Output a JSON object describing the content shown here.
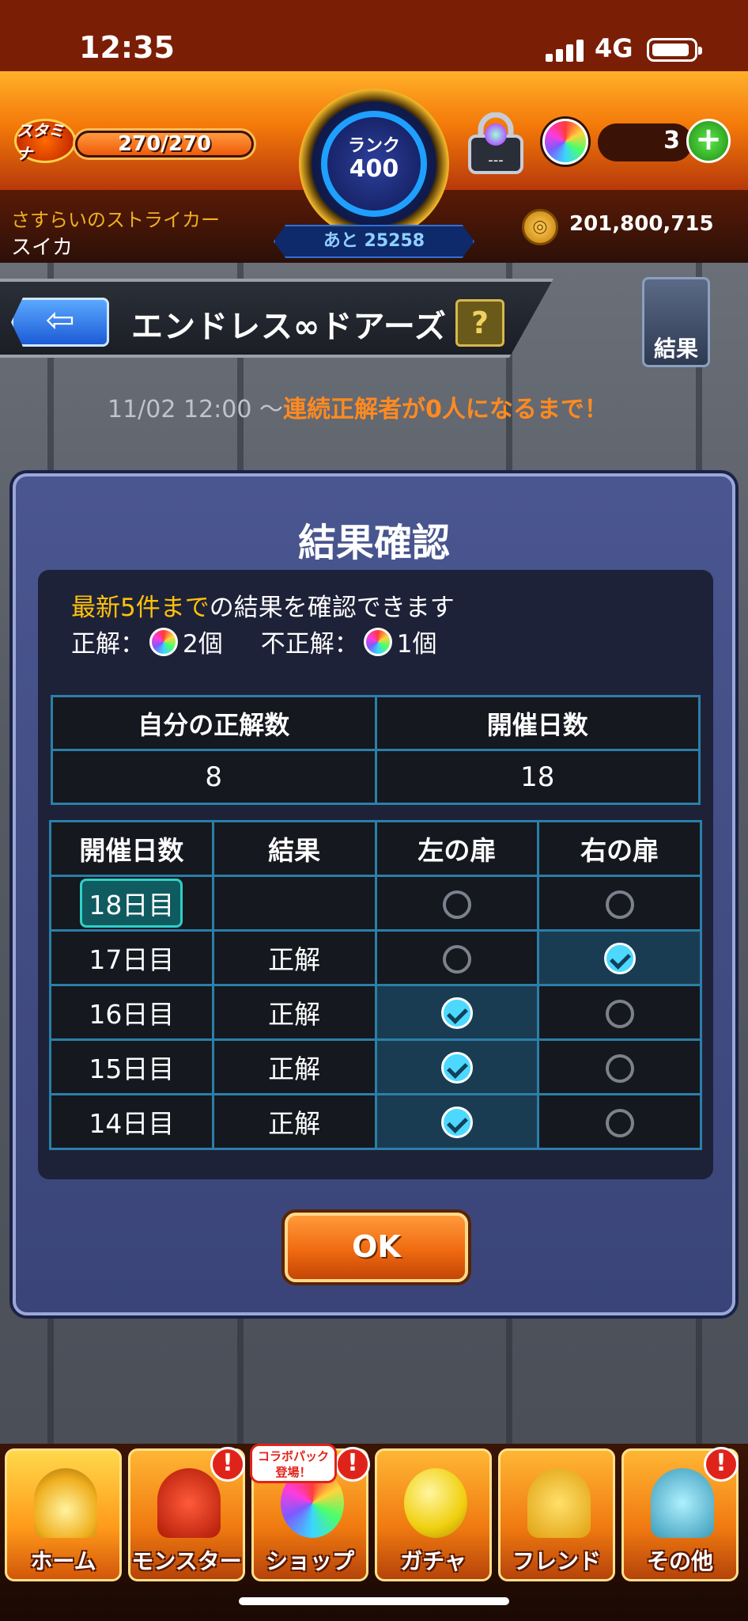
{
  "status_bar": {
    "time": "12:35",
    "network": "4G"
  },
  "header": {
    "stamina_label": "スタミナ",
    "stamina_value": "270/270",
    "stamina_fraction": 1.0,
    "rank_label": "ランク",
    "rank_value": "400",
    "rank_next": "あと 25258",
    "lock_text": "---",
    "gem_count": "3",
    "plus_symbol": "+",
    "player_title": "さすらいのストライカー",
    "player_name": "スイカ",
    "coin_count": "201,800,715"
  },
  "page": {
    "title": "エンドレス∞ドアーズ",
    "help_symbol": "?",
    "result_button": "結果",
    "event_period_start": "11/02 12:00 ～",
    "event_period_end": "連続正解者が0人になるまで！"
  },
  "modal": {
    "title": "結果確認",
    "info_highlight": "最新5件まで",
    "info_rest": "の結果を確認できます",
    "correct_label": "正解：",
    "correct_reward": "2個",
    "incorrect_label": "不正解：",
    "incorrect_reward": "1個",
    "summary": {
      "headers": [
        "自分の正解数",
        "開催日数"
      ],
      "values": [
        "8",
        "18"
      ]
    },
    "history": {
      "headers": [
        "開催日数",
        "結果",
        "左の扉",
        "右の扉"
      ],
      "rows": [
        {
          "day": "18日目",
          "result": "",
          "left": "unchecked",
          "right": "unchecked",
          "current": true
        },
        {
          "day": "17日目",
          "result": "正解",
          "left": "unchecked",
          "right": "checked",
          "current": false
        },
        {
          "day": "16日目",
          "result": "正解",
          "left": "checked",
          "right": "unchecked",
          "current": false
        },
        {
          "day": "15日目",
          "result": "正解",
          "left": "checked",
          "right": "unchecked",
          "current": false
        },
        {
          "day": "14日目",
          "result": "正解",
          "left": "checked",
          "right": "unchecked",
          "current": false
        }
      ]
    },
    "ok_label": "OK"
  },
  "bottom_nav": {
    "items": [
      {
        "label": "ホーム",
        "icon": "home-gate-icon",
        "alert": false
      },
      {
        "label": "モンスター",
        "icon": "monster-icon",
        "alert": true
      },
      {
        "label": "ショップ",
        "icon": "shop-gem-icon",
        "alert": true
      },
      {
        "label": "ガチャ",
        "icon": "gacha-egg-icon",
        "alert": false
      },
      {
        "label": "フレンド",
        "icon": "friend-icon",
        "alert": false
      },
      {
        "label": "その他",
        "icon": "other-menu-icon",
        "alert": true
      }
    ],
    "collab_bubble": "コラボパック登場！",
    "alert_symbol": "!"
  },
  "colors": {
    "accent_orange": "#f47a0a",
    "highlight_yellow": "#ffc20a",
    "table_border": "#2b7fa8",
    "check_blue": "#4dd8ff"
  }
}
